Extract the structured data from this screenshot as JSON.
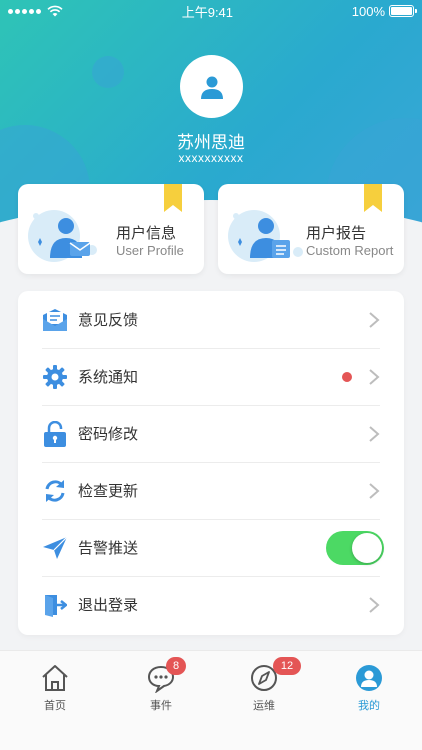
{
  "status_bar": {
    "time": "上午9:41",
    "battery": "100%"
  },
  "profile": {
    "name": "苏州思迪",
    "id": "xxxxxxxxxx"
  },
  "cards": [
    {
      "title": "用户信息",
      "subtitle": "User Profile",
      "icon": "user-profile-illustration"
    },
    {
      "title": "用户报告",
      "subtitle": "Custom Report",
      "icon": "custom-report-illustration"
    }
  ],
  "menu": [
    {
      "label": "意见反馈",
      "icon": "feedback-icon",
      "trailing": "chevron"
    },
    {
      "label": "系统通知",
      "icon": "gear-icon",
      "trailing": "dot-chevron"
    },
    {
      "label": "密码修改",
      "icon": "lock-icon",
      "trailing": "chevron"
    },
    {
      "label": "检查更新",
      "icon": "refresh-icon",
      "trailing": "chevron"
    },
    {
      "label": "告警推送",
      "icon": "paper-plane-icon",
      "trailing": "toggle",
      "toggle_on": true
    },
    {
      "label": "退出登录",
      "icon": "logout-icon",
      "trailing": "chevron"
    }
  ],
  "tabs": [
    {
      "label": "首页",
      "icon": "home-icon",
      "badge": ""
    },
    {
      "label": "事件",
      "icon": "chat-icon",
      "badge": "8"
    },
    {
      "label": "运维",
      "icon": "compass-icon",
      "badge": "12"
    },
    {
      "label": "我的",
      "icon": "user-icon",
      "badge": "",
      "active": true
    }
  ],
  "colors": {
    "accent": "#2b9ad6",
    "header_start": "#2ec4b6",
    "header_end": "#3aa6d8",
    "badge": "#e45555",
    "toggle_on": "#4cd964"
  }
}
